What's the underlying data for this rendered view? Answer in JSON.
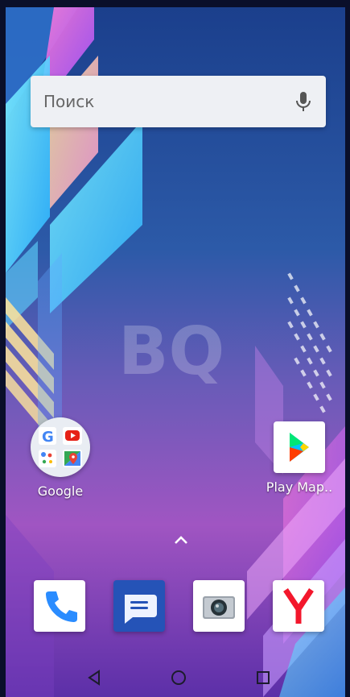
{
  "search": {
    "placeholder": "Поиск",
    "mic_icon": "mic-icon"
  },
  "wallpaper": {
    "logo_text": "BQ"
  },
  "desktop": {
    "folder": {
      "label": "Google",
      "apps": [
        "google-icon",
        "youtube-icon",
        "assistant-icon",
        "maps-icon"
      ]
    },
    "play_store": {
      "label": "Play Map.."
    }
  },
  "app_drawer": {
    "icon": "chevron-up-icon"
  },
  "dock": [
    {
      "name": "phone-icon"
    },
    {
      "name": "messages-icon"
    },
    {
      "name": "camera-icon"
    },
    {
      "name": "yandex-icon"
    }
  ],
  "navbar": {
    "back": "back-icon",
    "home": "home-icon",
    "recents": "recents-icon"
  }
}
